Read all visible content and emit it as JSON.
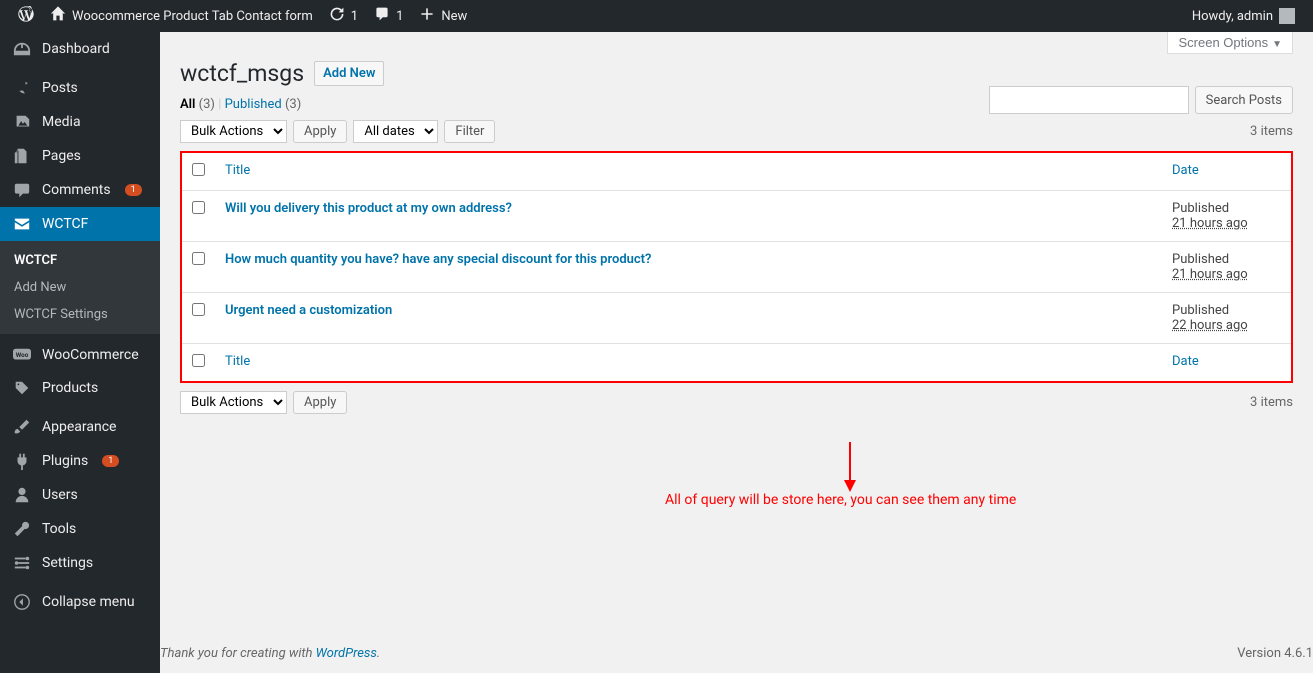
{
  "topbar": {
    "site_name": "Woocommerce Product Tab Contact form",
    "updates_count": "1",
    "comments_count": "1",
    "new_label": "New",
    "howdy": "Howdy, admin"
  },
  "sidebar": {
    "items": [
      {
        "label": "Dashboard",
        "icon": "dashboard"
      },
      {
        "label": "Posts",
        "icon": "pin"
      },
      {
        "label": "Media",
        "icon": "media"
      },
      {
        "label": "Pages",
        "icon": "page"
      },
      {
        "label": "Comments",
        "icon": "comment",
        "badge": "1"
      },
      {
        "label": "WCTCF",
        "icon": "mail",
        "current": true
      },
      {
        "label": "WooCommerce",
        "icon": "woo"
      },
      {
        "label": "Products",
        "icon": "product"
      },
      {
        "label": "Appearance",
        "icon": "brush"
      },
      {
        "label": "Plugins",
        "icon": "plug",
        "badge": "1"
      },
      {
        "label": "Users",
        "icon": "user"
      },
      {
        "label": "Tools",
        "icon": "wrench"
      },
      {
        "label": "Settings",
        "icon": "settings"
      }
    ],
    "submenu": [
      {
        "label": "WCTCF",
        "current": true
      },
      {
        "label": "Add New"
      },
      {
        "label": "WCTCF Settings"
      }
    ],
    "collapse": "Collapse menu"
  },
  "screen_options": "Screen Options",
  "heading": {
    "title": "wctcf_msgs",
    "add_new": "Add New"
  },
  "filters": {
    "all_label": "All",
    "all_count": "(3)",
    "published_label": "Published",
    "published_count": "(3)"
  },
  "search": {
    "button": "Search Posts"
  },
  "bulk": {
    "label": "Bulk Actions",
    "apply": "Apply"
  },
  "dates": {
    "all": "All dates",
    "filter": "Filter"
  },
  "items_count": "3 items",
  "table": {
    "col_title": "Title",
    "col_date": "Date",
    "rows": [
      {
        "title": "Will you delivery this product at my own address?",
        "status": "Published",
        "ago": "21 hours ago"
      },
      {
        "title": "How much quantity you have? have any special discount for this product?",
        "status": "Published",
        "ago": "21 hours ago"
      },
      {
        "title": "Urgent need a customization",
        "status": "Published",
        "ago": "22 hours ago"
      }
    ]
  },
  "annotation": "All of query will be store here, you can see them any time",
  "footer": {
    "thank": "Thank you for creating with ",
    "wp": "WordPress",
    "dot": ".",
    "version": "Version 4.6.1"
  }
}
